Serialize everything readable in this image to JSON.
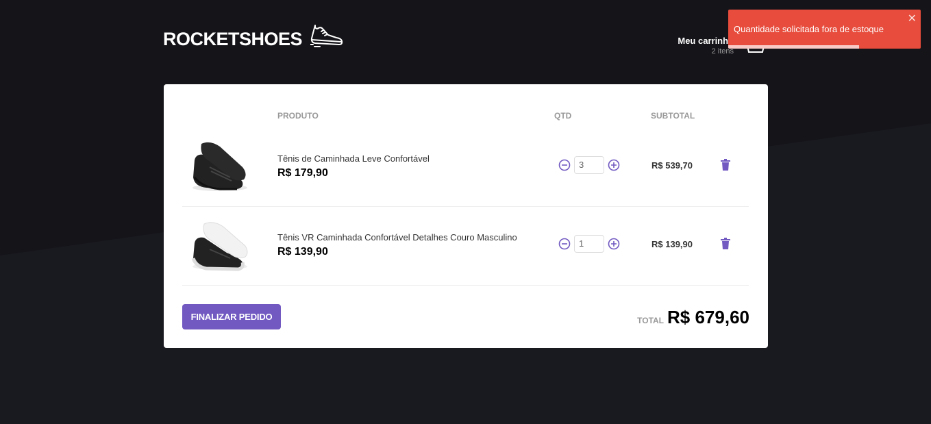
{
  "brand": {
    "name": "ROCKETSHOES",
    "logo_icon": "sneaker-icon"
  },
  "cart": {
    "title": "Meu carrinho",
    "count_text": "2 itens",
    "icon": "basket-icon"
  },
  "table": {
    "headers": {
      "product": "PRODUTO",
      "qty": "QTD",
      "subtotal": "SUBTOTAL"
    },
    "items": [
      {
        "name": "Tênis de Caminhada Leve Confortável",
        "price": "R$ 179,90",
        "quantity": "3",
        "subtotal": "R$ 539,70",
        "image": "black-sneaker-black-sole"
      },
      {
        "name": "Tênis VR Caminhada Confortável Detalhes Couro Masculino",
        "price": "R$ 139,90",
        "quantity": "1",
        "subtotal": "R$ 139,90",
        "image": "black-sneaker-white-sole"
      }
    ]
  },
  "footer": {
    "checkout_label": "FINALIZAR PEDIDO",
    "total_label": "TOTAL",
    "total_value": "R$ 679,60"
  },
  "toast": {
    "message": "Quantidade solicitada fora de estoque",
    "close": "✕",
    "progress": 0.68
  },
  "colors": {
    "background": "#191920",
    "accent": "#7159c1",
    "toast": "#e74c3c",
    "card": "#ffffff"
  }
}
